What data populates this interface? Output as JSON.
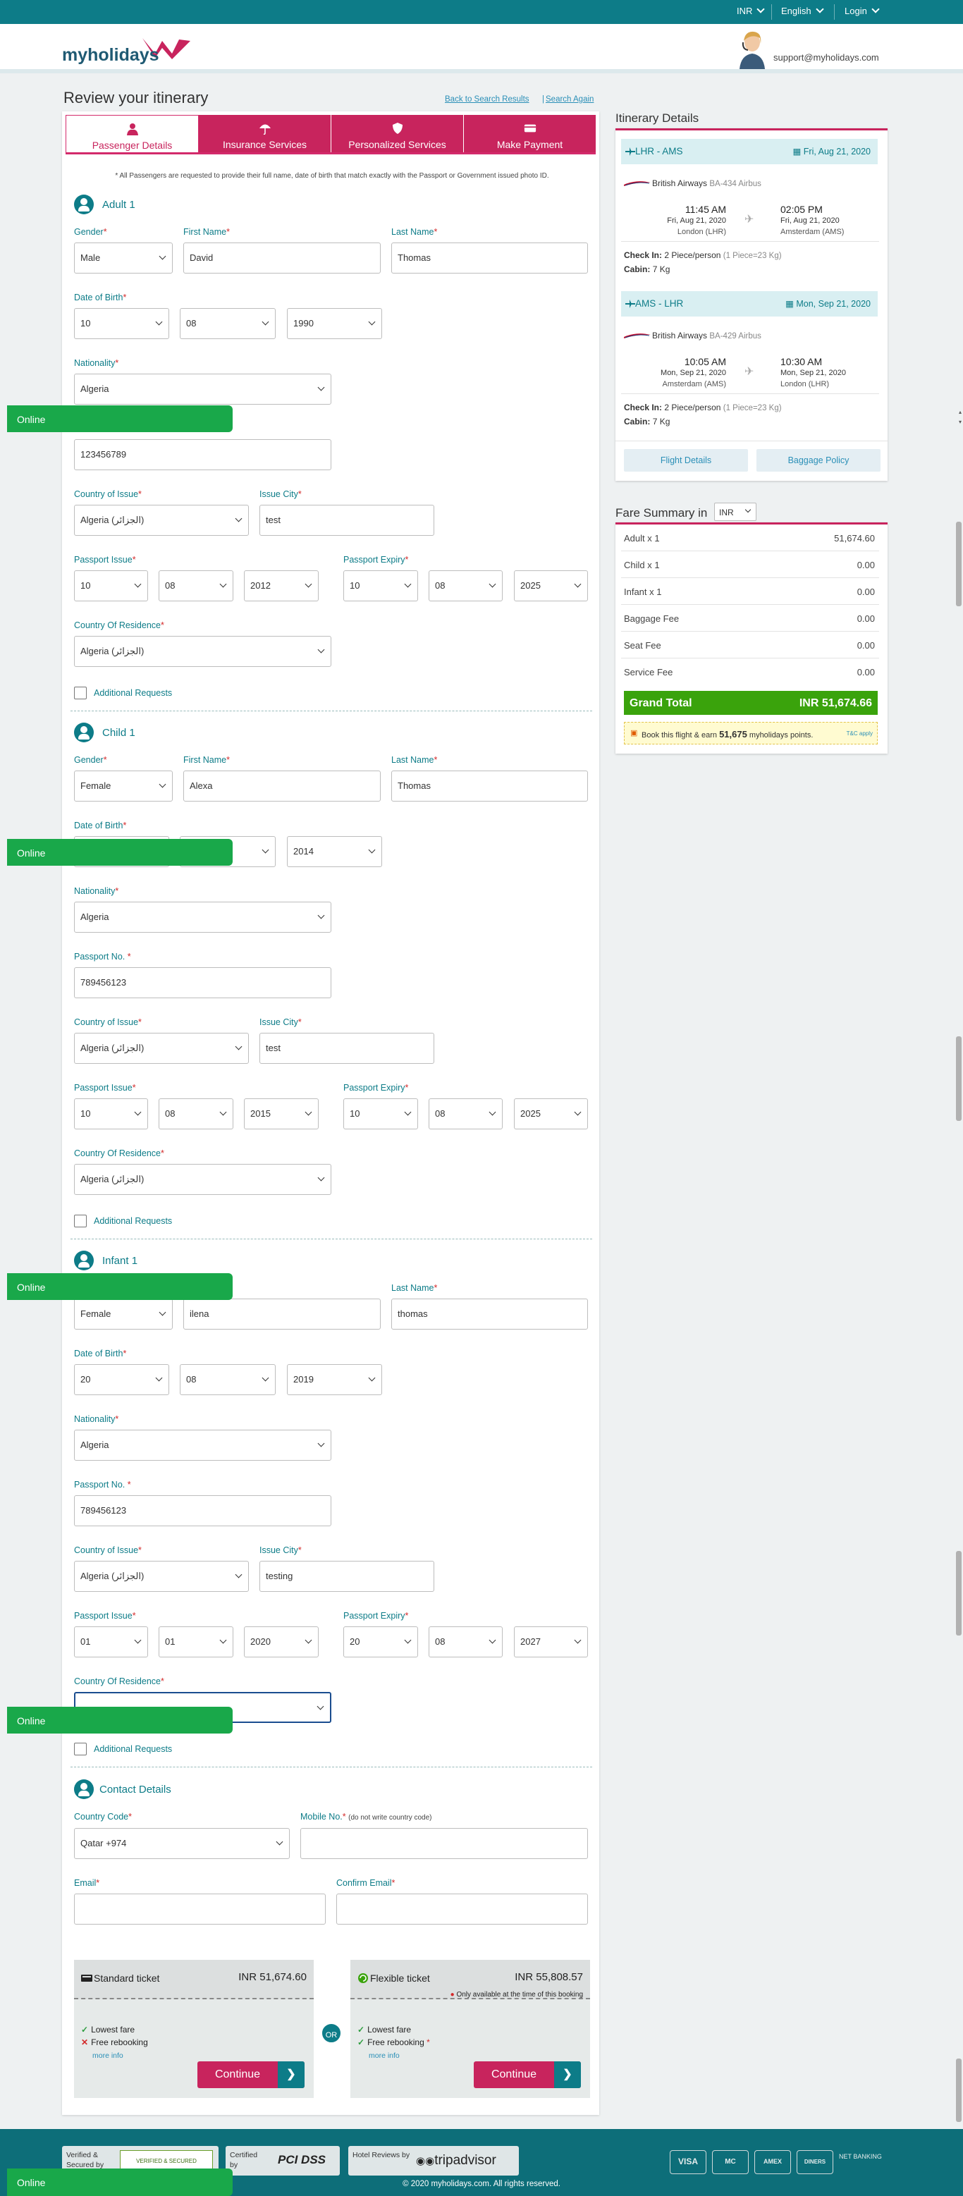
{
  "topbar": {
    "currency": "INR",
    "language": "English",
    "login": "Login"
  },
  "header": {
    "logo": "myholidays",
    "support_email": "support@myholidays.com"
  },
  "page": {
    "title": "Review your itinerary",
    "back_link": "Back to Search Results",
    "separator": "|",
    "search_again": "Search Again"
  },
  "tabs": [
    "Passenger Details",
    "Insurance Services",
    "Personalized Services",
    "Make Payment"
  ],
  "note": "* All Passengers are requested to provide their full name, date of birth that match exactly with the Passport or Government issued photo ID.",
  "labels": {
    "gender": "Gender",
    "first_name": "First Name",
    "last_name": "Last Name",
    "dob": "Date of Birth",
    "nationality": "Nationality",
    "passport_no": "Passport No. ",
    "country_of_issue": "Country of Issue",
    "issue_city": "Issue City",
    "passport_issue": "Passport Issue",
    "passport_expiry": "Passport Expiry",
    "country_residence": "Country Of Residence",
    "additional_requests": "Additional Requests",
    "star": "*"
  },
  "adult": {
    "title": "Adult 1",
    "gender": "Male",
    "first_name": "David",
    "last_name": "Thomas",
    "dob": [
      "10",
      "08",
      "1990"
    ],
    "nationality": "Algeria",
    "passport_no": "123456789",
    "country_of_issue": "Algeria (الجزائر)",
    "issue_city": "test",
    "passport_issue": [
      "10",
      "08",
      "2012"
    ],
    "passport_expiry": [
      "10",
      "08",
      "2025"
    ],
    "country_residence": "Algeria (الجزائر)"
  },
  "child": {
    "title": "Child 1",
    "gender": "Female",
    "first_name": "Alexa",
    "last_name": "Thomas",
    "dob": [
      "",
      "",
      "2014"
    ],
    "nationality": "Algeria",
    "passport_no": "789456123",
    "country_of_issue": "Algeria (الجزائر)",
    "issue_city": "test",
    "passport_issue": [
      "10",
      "08",
      "2015"
    ],
    "passport_expiry": [
      "10",
      "08",
      "2025"
    ],
    "country_residence": "Algeria (الجزائر)"
  },
  "infant": {
    "title": "Infant 1",
    "gender": "Female",
    "first_name": "ilena",
    "last_name": "thomas",
    "dob": [
      "20",
      "08",
      "2019"
    ],
    "nationality": "Algeria",
    "passport_no": "789456123",
    "country_of_issue": "Algeria (الجزائر)",
    "issue_city": "testing",
    "passport_issue": [
      "01",
      "01",
      "2020"
    ],
    "passport_expiry": [
      "20",
      "08",
      "2027"
    ],
    "country_residence": ""
  },
  "contact": {
    "title": "Contact Details",
    "country_code_label": "Country Code",
    "country_code": "Qatar +974",
    "mobile_label": "Mobile No.",
    "mobile_hint": "(do not write country code)",
    "email_label": "Email",
    "confirm_email_label": "Confirm Email"
  },
  "tickets": {
    "standard": {
      "name": "Standard ticket",
      "price": "INR 51,674.60",
      "f1": "Lowest fare",
      "f2": "Free rebooking",
      "more": "more info",
      "btn": "Continue"
    },
    "flexible": {
      "name": "Flexible ticket",
      "price": "INR 55,808.57",
      "note": "Only available at the time of this booking",
      "f1": "Lowest fare",
      "f2": "Free rebooking",
      "more": "more info",
      "btn": "Continue"
    },
    "or": "OR",
    "arrow": "❯"
  },
  "online": "Online",
  "itinerary": {
    "title": "Itinerary Details",
    "seg1": {
      "route": "LHR - AMS",
      "date": "Fri, Aug 21, 2020",
      "airline": "British Airways",
      "flight": "BA-434 Airbus",
      "dep_time": "11:45 AM",
      "dep_date": "Fri, Aug 21, 2020",
      "dep_city": "London (LHR)",
      "arr_time": "02:05 PM",
      "arr_date": "Fri, Aug 21, 2020",
      "arr_city": "Amsterdam (AMS)",
      "checkin_label": "Check In:",
      "checkin": "2 Piece/person",
      "checkin_note": "(1 Piece=23 Kg)",
      "cabin_label": "Cabin:",
      "cabin": "7 Kg"
    },
    "seg2": {
      "route": "AMS - LHR",
      "date": "Mon, Sep 21, 2020",
      "airline": "British Airways",
      "flight": "BA-429 Airbus",
      "dep_time": "10:05 AM",
      "dep_date": "Mon, Sep 21, 2020",
      "dep_city": "Amsterdam (AMS)",
      "arr_time": "10:30 AM",
      "arr_date": "Mon, Sep 21, 2020",
      "arr_city": "London (LHR)",
      "checkin_label": "Check In:",
      "checkin": "2 Piece/person",
      "checkin_note": "(1 Piece=23 Kg)",
      "cabin_label": "Cabin:",
      "cabin": "7 Kg"
    },
    "flight_details": "Flight Details",
    "baggage_policy": "Baggage Policy"
  },
  "fare": {
    "title": "Fare Summary in",
    "currency": "INR",
    "rows": [
      {
        "label": "Adult x 1",
        "value": "51,674.60"
      },
      {
        "label": "Child x 1",
        "value": "0.00"
      },
      {
        "label": "Infant x 1",
        "value": "0.00"
      },
      {
        "label": "Baggage Fee",
        "value": "0.00"
      },
      {
        "label": "Seat Fee",
        "value": "0.00"
      },
      {
        "label": "Service Fee",
        "value": "0.00"
      }
    ],
    "grand_label": "Grand Total",
    "grand_value": "INR 51,674.66",
    "promo_pre": "Book this flight & earn",
    "promo_points": "51,675",
    "promo_post": "myholidays points.",
    "promo_tc": "T&C apply"
  },
  "footer": {
    "verified": "Verified & Secured by",
    "godaddy": "VERIFIED & SECURED",
    "certified": "Certified by",
    "pci": "PCI DSS",
    "reviews": "Hotel Reviews by",
    "tripadvisor": "tripadvisor",
    "cards": [
      "VISA",
      "MC",
      "AMEX",
      "DINERS",
      "NET BANKING"
    ],
    "copyright": "© 2020 myholidays.com. All rights reserved."
  },
  "colors": {
    "teal": "#0d7c88",
    "magenta": "#c8245d",
    "green": "#3aa30c",
    "online_green": "#19a84a"
  }
}
